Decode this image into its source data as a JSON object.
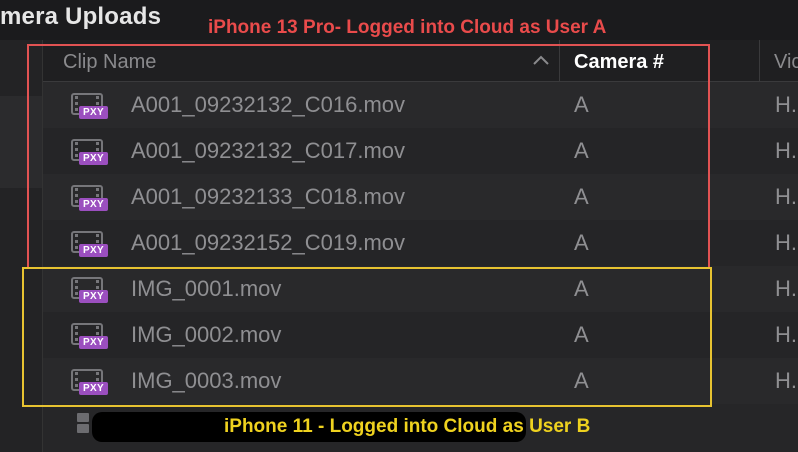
{
  "window": {
    "title": "mera Uploads"
  },
  "table": {
    "columns": {
      "clip_name": "Clip Name",
      "camera": "Camera #",
      "video": "Vic"
    },
    "rows": [
      {
        "clip_name": "A001_09232132_C016.mov",
        "camera": "A",
        "video": "H.",
        "badge": "PXY"
      },
      {
        "clip_name": "A001_09232132_C017.mov",
        "camera": "A",
        "video": "H.",
        "badge": "PXY"
      },
      {
        "clip_name": "A001_09232133_C018.mov",
        "camera": "A",
        "video": "H.",
        "badge": "PXY"
      },
      {
        "clip_name": "A001_09232152_C019.mov",
        "camera": "A",
        "video": "H.",
        "badge": "PXY"
      },
      {
        "clip_name": "IMG_0001.mov",
        "camera": "A",
        "video": "H.",
        "badge": "PXY"
      },
      {
        "clip_name": "IMG_0002.mov",
        "camera": "A",
        "video": "H.",
        "badge": "PXY"
      },
      {
        "clip_name": "IMG_0003.mov",
        "camera": "A",
        "video": "H.",
        "badge": "PXY"
      }
    ]
  },
  "annotations": {
    "group_a": "iPhone 13 Pro- Logged into Cloud as User A",
    "group_b": "iPhone 11 - Logged into Cloud as User B",
    "group_a_color": "#e94b4b",
    "group_b_color": "#efd21f"
  },
  "colors": {
    "proxy_badge": "#9b4fbf",
    "background": "#1b1b1d"
  },
  "icons": {
    "clip": "proxy-clip-icon",
    "sort": "sort-ascending-icon"
  }
}
